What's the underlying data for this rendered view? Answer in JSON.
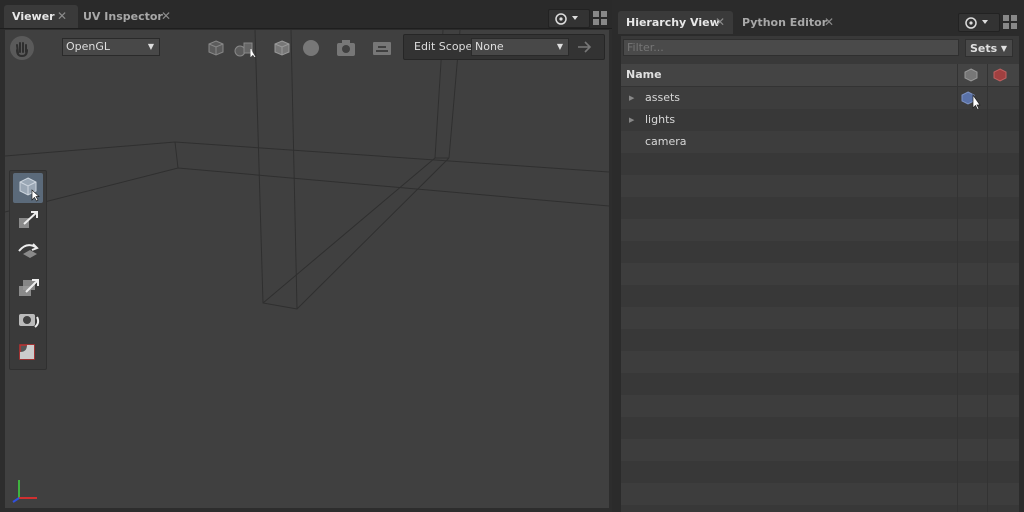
{
  "left_tabs": [
    {
      "label": "Viewer",
      "active": true
    },
    {
      "label": "UV Inspector",
      "active": false
    }
  ],
  "right_tabs": [
    {
      "label": "Hierarchy View",
      "active": true
    },
    {
      "label": "Python Editor",
      "active": false
    }
  ],
  "viewer": {
    "renderer": "OpenGL",
    "edit_scope_label": "Edit Scope",
    "edit_scope_value": "None",
    "toolbar_icons": [
      "hand-icon",
      "render-mode-icon",
      "object-display-icon",
      "cube-icon",
      "sphere-icon",
      "camera-icon",
      "overlay-icon"
    ],
    "tools": [
      "select-tool",
      "translate-tool",
      "rotate-tool",
      "scale-tool",
      "camera-tool",
      "crop-tool"
    ]
  },
  "hierarchy": {
    "filter_placeholder": "Filter...",
    "sets_label": "Sets",
    "column_name": "Name",
    "column_icons": [
      "visible-column-icon",
      "selected-column-icon"
    ],
    "items": [
      {
        "label": "assets",
        "expandable": true
      },
      {
        "label": "lights",
        "expandable": true
      },
      {
        "label": "camera",
        "expandable": false
      }
    ]
  },
  "colors": {
    "accent": "#5b6a7a",
    "viewport_bg": "#404040",
    "panel_bg": "#2b2b2b"
  }
}
